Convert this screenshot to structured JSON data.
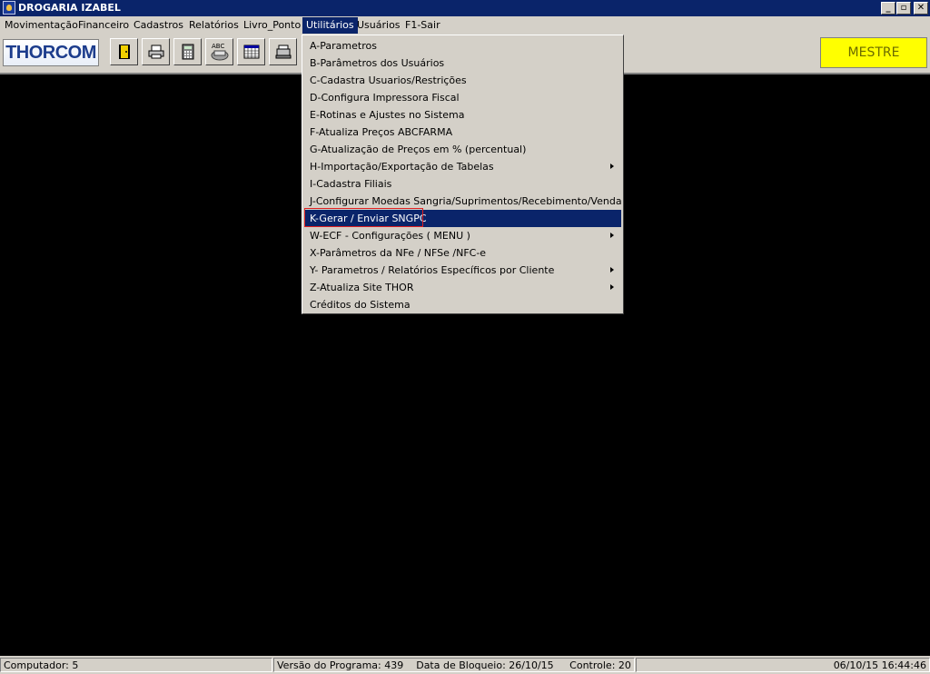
{
  "window": {
    "title": "DROGARIA IZABEL",
    "min_label": "_",
    "max_label": "▫",
    "close_label": "✕"
  },
  "menubar": {
    "items": [
      {
        "label": "Movimentação"
      },
      {
        "label": "Financeiro"
      },
      {
        "label": "Cadastros"
      },
      {
        "label": "Relatórios"
      },
      {
        "label": "Livro_Ponto"
      },
      {
        "label": "Utilitários"
      },
      {
        "label": "Usuários"
      },
      {
        "label": "F1-Sair"
      }
    ]
  },
  "toolbar": {
    "logo_text": "THORCOM",
    "user_badge": "MESTRE",
    "buttons": [
      {
        "icon": "exit-door-icon"
      },
      {
        "icon": "printer-icon"
      },
      {
        "icon": "calculator-icon"
      },
      {
        "icon": "abc-spellcheck-icon"
      },
      {
        "icon": "calendar-icon"
      },
      {
        "icon": "cash-register-icon"
      }
    ]
  },
  "utilitarios_menu": {
    "items": [
      {
        "label": "A-Parametros"
      },
      {
        "label": "B-Parâmetros dos Usuários"
      },
      {
        "label": "C-Cadastra Usuarios/Restrições"
      },
      {
        "label": "D-Configura Impressora Fiscal"
      },
      {
        "label": "E-Rotinas e Ajustes  no Sistema"
      },
      {
        "label": "F-Atualiza Preços ABCFARMA"
      },
      {
        "label": "G-Atualização de Preços em % (percentual)"
      },
      {
        "label": "H-Importação/Exportação de Tabelas",
        "submenu": true
      },
      {
        "label": "I-Cadastra Filiais"
      },
      {
        "label": "J-Configurar Moedas Sangria/Suprimentos/Recebimento/Venda Cupom"
      },
      {
        "label": "K-Gerar / Enviar SNGPC",
        "selected": true
      },
      {
        "label": "W-ECF - Configurações ( MENU )",
        "submenu": true
      },
      {
        "label": "X-Parâmetros da NFe / NFSe /NFC-e"
      },
      {
        "label": "Y- Parametros / Relatórios Específicos por Cliente",
        "submenu": true
      },
      {
        "label": "Z-Atualiza Site THOR",
        "submenu": true
      },
      {
        "label": "Créditos do Sistema"
      }
    ]
  },
  "statusbar": {
    "computer": "Computador: 5",
    "version": "Versão do Programa: 439",
    "block_date": "Data de Bloqueio: 26/10/15",
    "control": "Controle: 20",
    "datetime": "06/10/15 16:44:46"
  }
}
